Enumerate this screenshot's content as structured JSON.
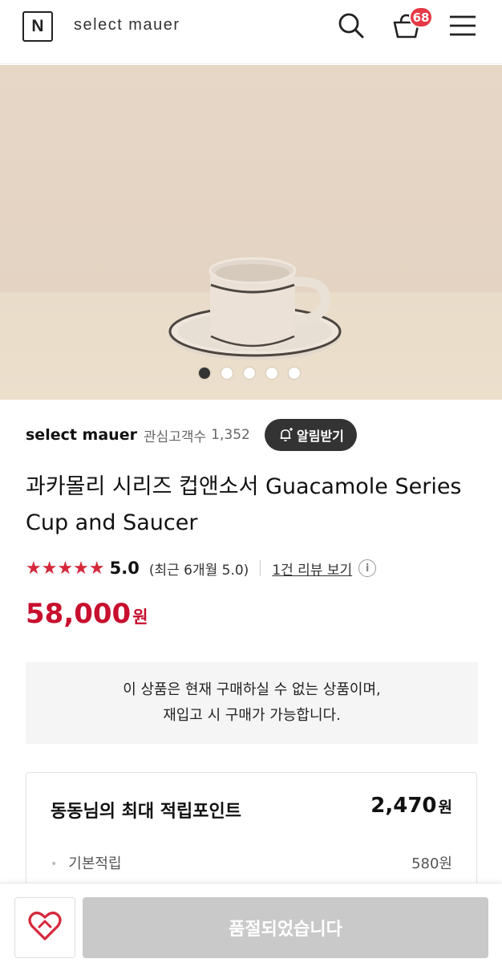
{
  "header": {
    "logo_letter": "N",
    "store_name": "select mauer",
    "cart_count": "68",
    "icons": [
      "search-icon",
      "cart-icon",
      "menu-icon"
    ]
  },
  "gallery": {
    "image_count": 5,
    "active_index": 0
  },
  "store": {
    "name": "select mauer",
    "followers_label": "관심고객수",
    "followers_count": "1,352",
    "notify_label": "알림받기"
  },
  "product": {
    "title": "과카몰리 시리즈 컵앤소서 Guacamole Series Cup and Saucer",
    "rating_stars": "★★★★★",
    "rating_score": "5.0",
    "rating_recent": "(최근 6개월 5.0)",
    "review_link": "1건 리뷰 보기",
    "price_value": "58,000",
    "price_unit": "원"
  },
  "notice": {
    "line1": "이 상품은 현재 구매하실 수 없는 상품이며,",
    "line2": "재입고 시 구매가 가능합니다."
  },
  "points": {
    "title": "동동님의 최대 적립포인트",
    "total_value": "2,470",
    "total_unit": "원",
    "basic_label": "기본적립",
    "basic_value": "580원"
  },
  "bottom_bar": {
    "soldout_label": "품절되었습니다"
  },
  "colors": {
    "accent_red": "#c8102e",
    "star_red": "#d6283b",
    "badge_red": "#e63946",
    "dark_button": "#333333",
    "disabled_button": "#c9c9c9"
  }
}
